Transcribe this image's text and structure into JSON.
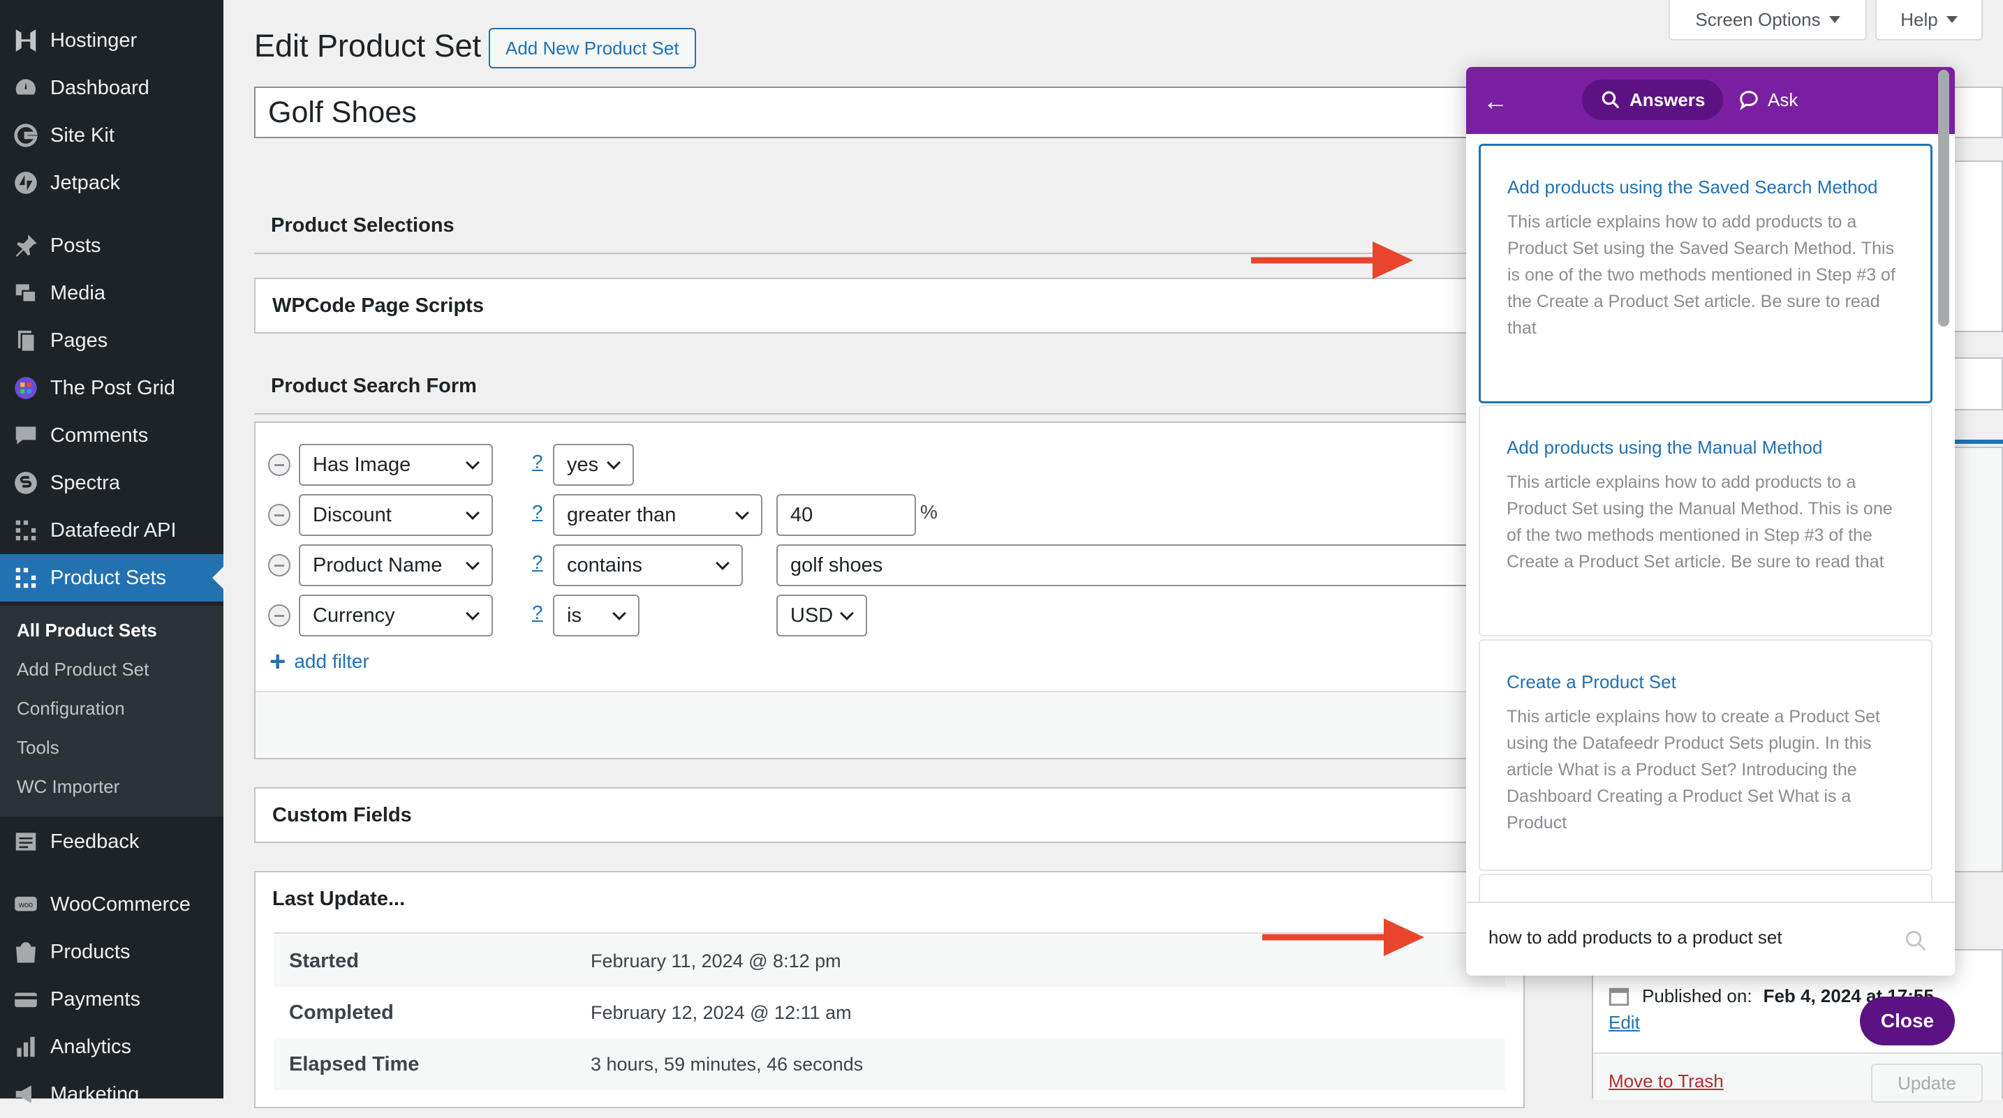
{
  "sidebar": {
    "items": [
      {
        "label": "Hostinger",
        "icon": "hostinger-icon"
      },
      {
        "label": "Dashboard",
        "icon": "dashboard-icon"
      },
      {
        "label": "Site Kit",
        "icon": "google-icon"
      },
      {
        "label": "Jetpack",
        "icon": "jetpack-icon"
      },
      {
        "label": "Posts",
        "icon": "pin-icon"
      },
      {
        "label": "Media",
        "icon": "media-icon"
      },
      {
        "label": "Pages",
        "icon": "pages-icon"
      },
      {
        "label": "The Post Grid",
        "icon": "post-grid-icon"
      },
      {
        "label": "Comments",
        "icon": "comments-icon"
      },
      {
        "label": "Spectra",
        "icon": "spectra-icon"
      },
      {
        "label": "Datafeedr API",
        "icon": "grid-icon"
      },
      {
        "label": "Product Sets",
        "icon": "grid-icon"
      },
      {
        "label": "Feedback",
        "icon": "feedback-icon"
      },
      {
        "label": "WooCommerce",
        "icon": "woo-icon"
      },
      {
        "label": "Products",
        "icon": "bag-icon"
      },
      {
        "label": "Payments",
        "icon": "payments-icon"
      },
      {
        "label": "Analytics",
        "icon": "analytics-icon"
      },
      {
        "label": "Marketing",
        "icon": "megaphone-icon"
      }
    ],
    "submenu": [
      "All Product Sets",
      "Add Product Set",
      "Configuration",
      "Tools",
      "WC Importer"
    ]
  },
  "header": {
    "screen_options": "Screen Options",
    "help": "Help",
    "page_title": "Edit Product Set",
    "add_new": "Add New Product Set",
    "title_value": "Golf Shoes"
  },
  "boxes": {
    "product_selections": "Product Selections",
    "wpcode": "WPCode Page Scripts",
    "product_search_form": "Product Search Form",
    "custom_fields": "Custom Fields",
    "last_update": "Last Update..."
  },
  "filters": [
    {
      "field": "Has Image",
      "help": "?",
      "operator": "yes",
      "value": ""
    },
    {
      "field": "Discount",
      "help": "?",
      "operator": "greater than",
      "value": "40",
      "suffix": "%"
    },
    {
      "field": "Product Name",
      "help": "?",
      "operator": "contains",
      "value": "golf shoes"
    },
    {
      "field": "Currency",
      "help": "?",
      "operator": "is",
      "value": "USD"
    }
  ],
  "add_filter": "add filter",
  "last_update": [
    {
      "label": "Started",
      "value": "February 11, 2024 @ 8:12 pm"
    },
    {
      "label": "Completed",
      "value": "February 12, 2024 @ 12:11 am"
    },
    {
      "label": "Elapsed Time",
      "value": "3 hours, 59 minutes, 46 seconds"
    }
  ],
  "publish": {
    "published_label": "Published on:",
    "published_date": "Feb 4, 2024 at 17:55",
    "edit": "Edit",
    "trash": "Move to Trash",
    "update": "Update"
  },
  "beacon": {
    "tab_answers": "Answers",
    "tab_ask": "Ask",
    "articles": [
      {
        "title": "Add products using the Saved Search Method",
        "desc": "This article explains how to add products to a Product Set using the Saved Search Method. This is one of the two methods mentioned in Step #3 of the Create a Product Set article. Be sure to read that"
      },
      {
        "title": "Add products using the Manual Method",
        "desc": "This article explains how to add products to a Product Set using the Manual Method. This is one of the two methods mentioned in Step #3 of the Create a Product Set article. Be sure to read that"
      },
      {
        "title": "Create a Product Set",
        "desc": "This article explains how to create a Product Set using the Datafeedr Product Sets plugin. In this article What is a Product Set? Introducing the Dashboard Creating a Product Set What is a Product"
      }
    ],
    "search_value": "how to add products to a product set",
    "close": "Close"
  },
  "colors": {
    "sidebar_bg": "#1d2327",
    "active_blue": "#2271b1",
    "beacon_purple": "#7b1fa2",
    "arrow_red": "#e8452c"
  }
}
